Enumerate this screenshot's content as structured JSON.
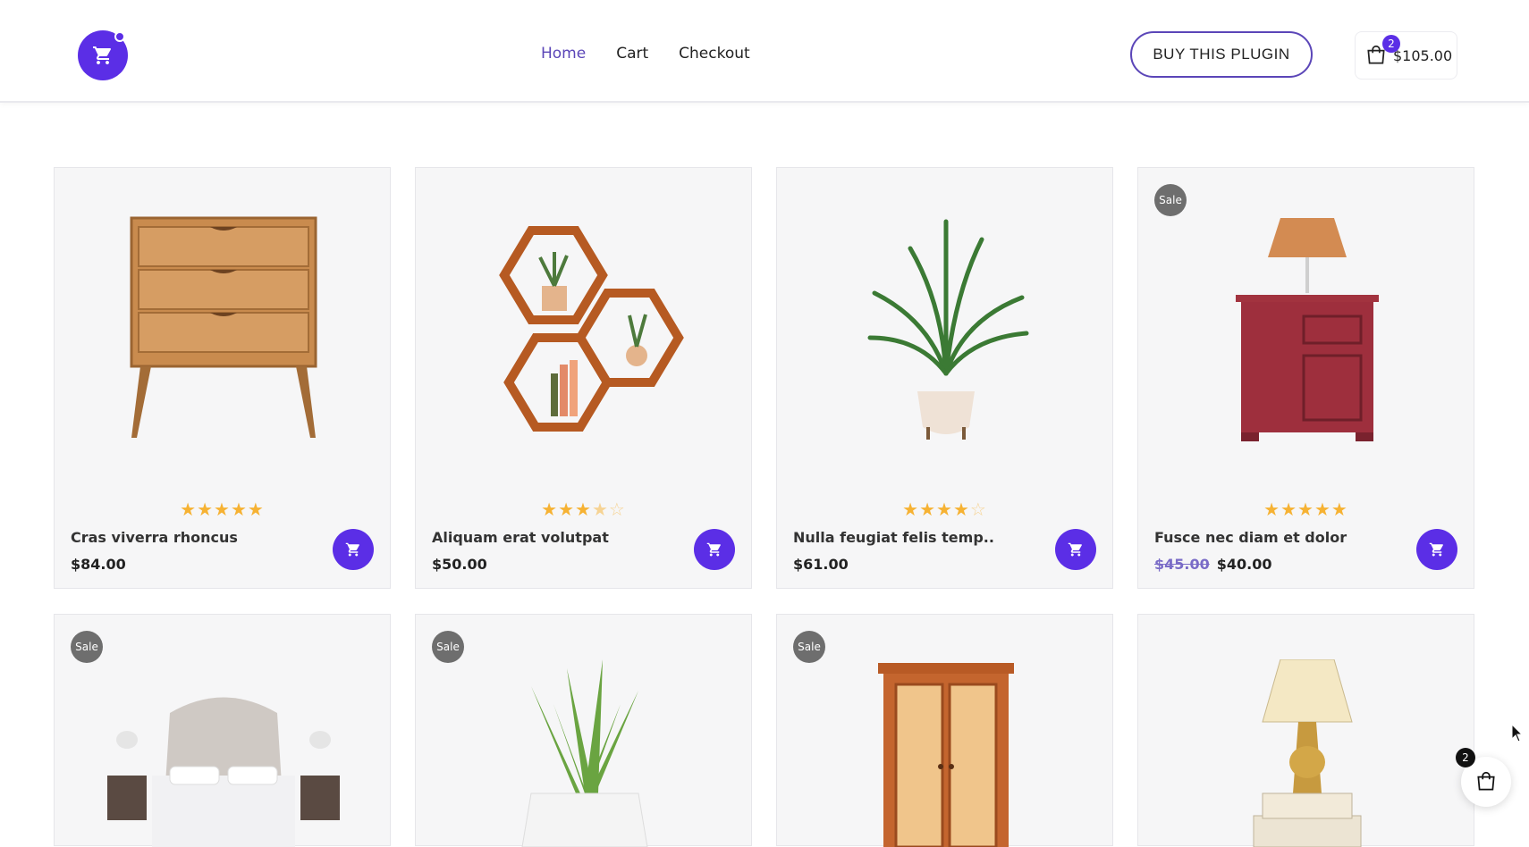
{
  "header": {
    "nav": [
      {
        "label": "Home",
        "active": true
      },
      {
        "label": "Cart",
        "active": false
      },
      {
        "label": "Checkout",
        "active": false
      }
    ],
    "buy_label": "BUY THIS PLUGIN",
    "cart_count": "2",
    "cart_total": "$105.00"
  },
  "colors": {
    "accent": "#5b2ee6",
    "star": "#f6b233",
    "sale_badge": "#6e6e6e"
  },
  "products": [
    {
      "name": "Cras viverra rhoncus",
      "price": "$84.00",
      "old_price": "",
      "rating": 5,
      "sale": false,
      "image": "wooden-dresser"
    },
    {
      "name": "Aliquam erat volutpat",
      "price": "$50.00",
      "old_price": "",
      "rating": 3.5,
      "sale": false,
      "image": "hexagon-shelves"
    },
    {
      "name": "Nulla feugiat felis temp..",
      "price": "$61.00",
      "old_price": "",
      "rating": 4,
      "sale": false,
      "image": "potted-palm"
    },
    {
      "name": "Fusce nec diam et dolor",
      "price": "$40.00",
      "old_price": "$45.00",
      "rating": 5,
      "sale": true,
      "image": "red-nightstand-lamp"
    },
    {
      "sale": true,
      "image": "tufted-bed"
    },
    {
      "sale": true,
      "image": "aloe-plant"
    },
    {
      "sale": true,
      "image": "wooden-wardrobe"
    },
    {
      "sale": false,
      "image": "table-lamp"
    }
  ],
  "sale_label": "Sale",
  "floating_cart": {
    "count": "2"
  }
}
